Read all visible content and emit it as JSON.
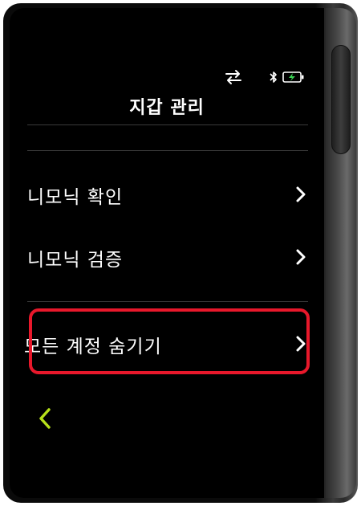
{
  "header": {
    "title": "지갑 관리"
  },
  "status_bar": {
    "icons": [
      "swap-arrows-icon",
      "bluetooth-icon",
      "battery-charging-icon"
    ],
    "battery_color": "#39d353"
  },
  "menu": {
    "items": [
      {
        "label": "니모닉 확인",
        "icon": "chevron-right-icon"
      },
      {
        "label": "니모닉 검증",
        "icon": "chevron-right-icon"
      },
      {
        "label": "모든 계정 숨기기",
        "icon": "chevron-right-icon",
        "highlighted": true
      }
    ]
  },
  "navigation": {
    "back_icon": "chevron-left-icon",
    "back_color": "#b6e01a"
  },
  "colors": {
    "screen_background": "#000000",
    "text": "#ffffff",
    "highlight_border": "#e8182b",
    "accent": "#b6e01a"
  }
}
